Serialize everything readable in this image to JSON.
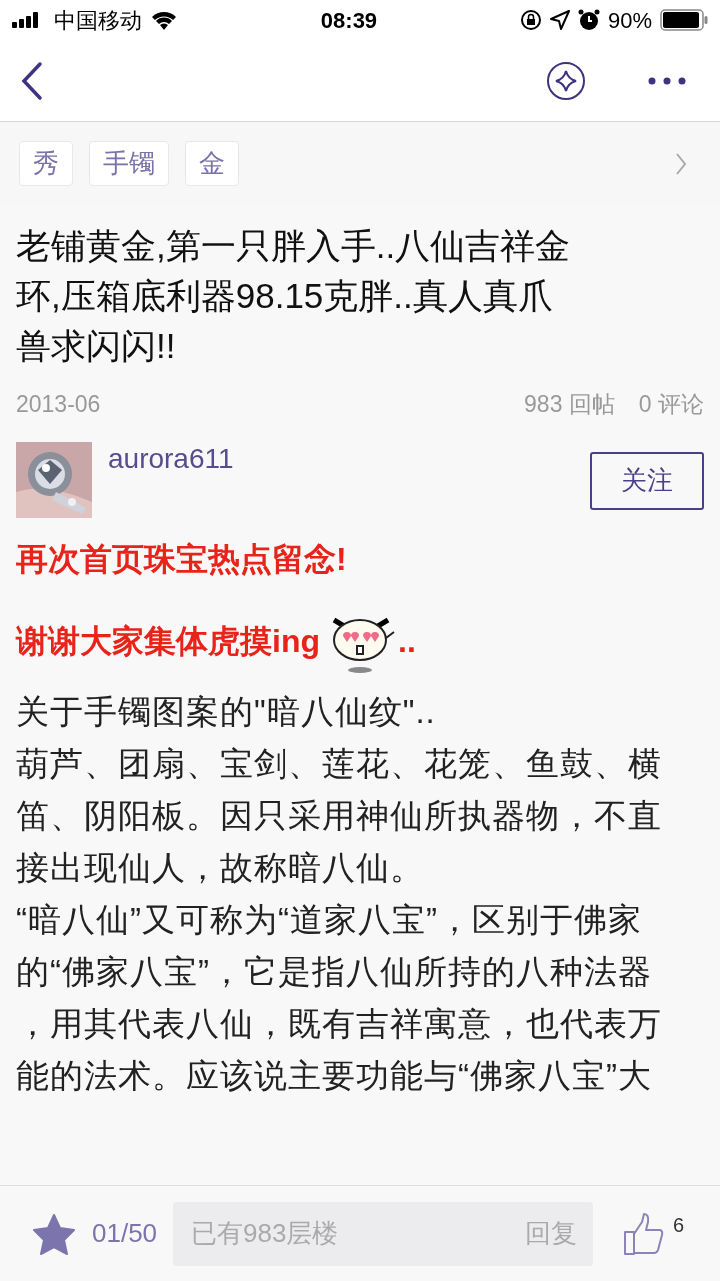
{
  "status_bar": {
    "carrier": "中国移动",
    "time": "08:39",
    "battery": "90%"
  },
  "tags": [
    {
      "label": "秀"
    },
    {
      "label": "手镯"
    },
    {
      "label": "金"
    }
  ],
  "title_lines": [
    "老铺黄金,第一只胖入手..八仙吉祥金",
    "环,压箱底利器98.15克胖..真人真爪",
    "兽求闪闪!!"
  ],
  "meta": {
    "date": "2013-06",
    "replies": "983 回帖",
    "comments": "0 评论"
  },
  "author": {
    "name": "aurora611",
    "follow_button": "关注"
  },
  "highlights": [
    {
      "text": "再次首页珠宝热点留念!",
      "emoji": false
    },
    {
      "text": "谢谢大家集体虎摸ing",
      "emoji": true,
      "after": ".."
    }
  ],
  "body_lines": [
    "关于手镯图案的\"暗八仙纹\"..",
    "葫芦、团扇、宝剑、莲花、花笼、鱼鼓、横",
    "笛、阴阳板。因只采用神仙所执器物，不直",
    "接出现仙人，故称暗八仙。",
    "“暗八仙”又可称为“道家八宝”，区别于佛家",
    "的“佛家八宝”，它是指八仙所持的八种法器",
    "，用其代表八仙，既有吉祥寓意，也代表万",
    "能的法术。应该说主要功能与“佛家八宝”大"
  ],
  "bottom_bar": {
    "page": "01/50",
    "reply_placeholder": "已有983层楼",
    "reply_button": "回复",
    "likes": "6"
  }
}
